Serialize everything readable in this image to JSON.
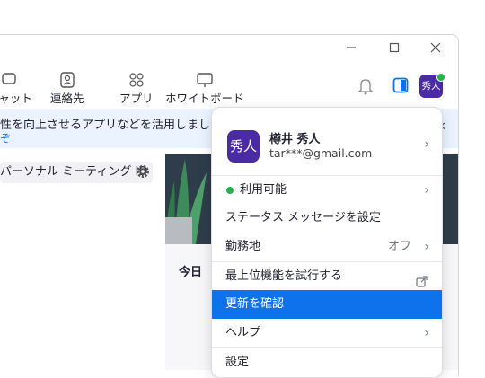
{
  "toolbar": {
    "chat": "チャット",
    "contacts": "連絡先",
    "apps": "アプリ",
    "whiteboard": "ホワイトボード",
    "avatar": "秀人"
  },
  "banner": {
    "text": "性を向上させるアプリなどを活用しましょう",
    "link": "ぞ"
  },
  "pmi": "パーソナル ミーティング ID",
  "today": "今日",
  "menu": {
    "avatar": "秀人",
    "name": "樽井 秀人",
    "email": "tar***@gmail.com",
    "status": "利用可能",
    "set_status": "ステータス メッセージを設定",
    "work_location": "勤務地",
    "work_location_value": "オフ",
    "try_top": "最上位機能を試行する",
    "check_updates": "更新を確認",
    "help": "ヘルプ",
    "settings": "設定"
  },
  "colors": {
    "accent": "#0e72ed",
    "highlight": "#0e72ed",
    "status_green": "#22b34a",
    "avatar_bg": "#4a2ba3"
  }
}
